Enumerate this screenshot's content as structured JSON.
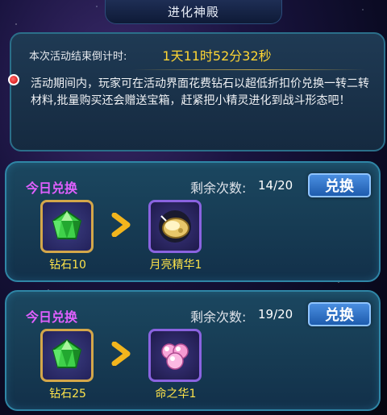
{
  "title": "进化神殿",
  "countdown": {
    "label": "本次活动结束倒计时:",
    "value": "1天11时52分32秒"
  },
  "description": "活动期间内，玩家可在活动界面花费钻石以超低折扣价兑换一转二转材料,批量购买还会赠送宝箱，赶紧把小精灵进化到战斗形态吧！",
  "exchanges": [
    {
      "today_label": "今日兑换",
      "remain_label": "剩余次数:",
      "remain_count": "14/20",
      "button_label": "兑换",
      "cost_item": {
        "name": "钻石10",
        "icon": "green-diamond-icon"
      },
      "reward_item": {
        "name": "月亮精华1",
        "icon": "moon-essence-icon"
      }
    },
    {
      "today_label": "今日兑换",
      "remain_label": "剩余次数:",
      "remain_count": "19/20",
      "button_label": "兑换",
      "cost_item": {
        "name": "钻石25",
        "icon": "green-diamond-icon"
      },
      "reward_item": {
        "name": "命之华1",
        "icon": "life-essence-icon"
      }
    }
  ],
  "colors": {
    "accent_gold": "#ffd633",
    "today_purple": "#e060ff",
    "button_blue": "#1e5cae"
  }
}
